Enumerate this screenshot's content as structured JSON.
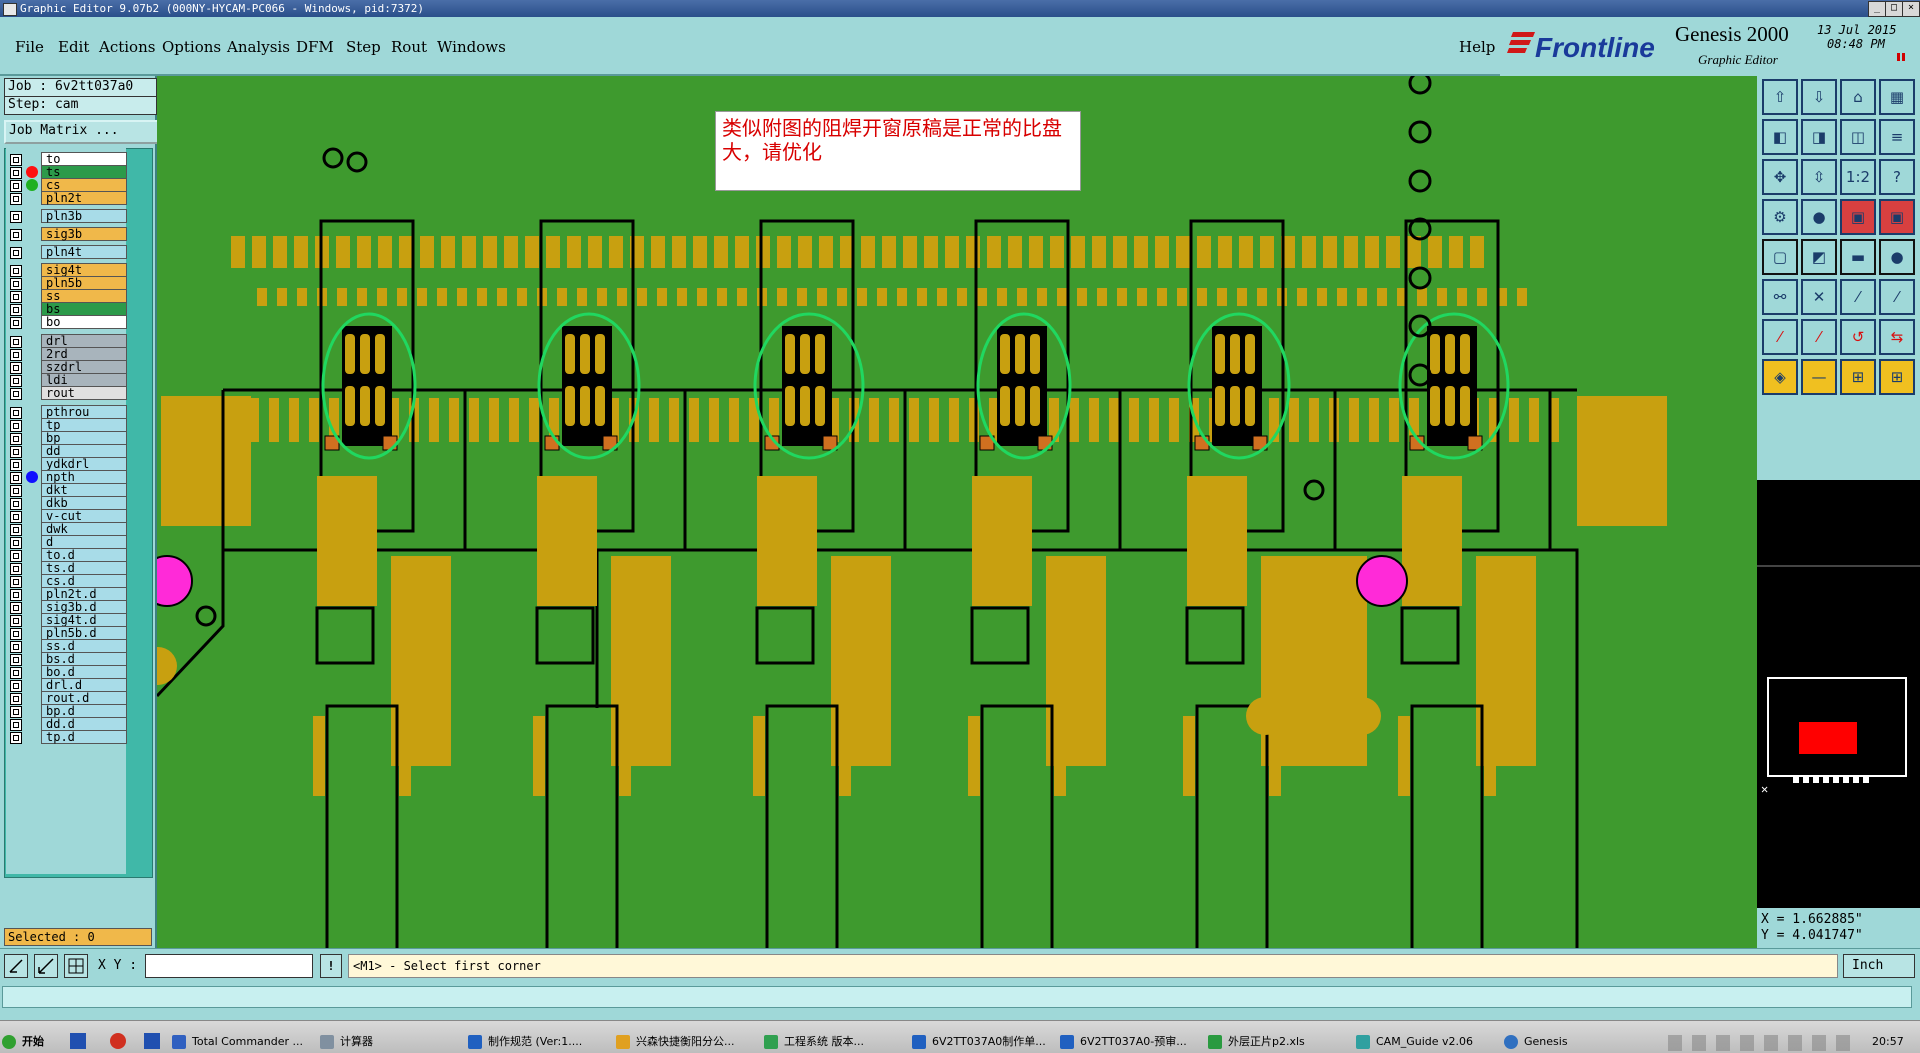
{
  "window": {
    "title": "Graphic Editor 9.07b2 (000NY-HYCAM-PC066 - Windows, pid:7372)",
    "controls": [
      "_",
      "□",
      "×"
    ]
  },
  "menu": [
    "File",
    "Edit",
    "Actions",
    "Options",
    "Analysis",
    "DFM",
    "Step",
    "Rout",
    "Windows"
  ],
  "help_label": "Help",
  "brand": {
    "logo": "Frontline",
    "product": "Genesis 2000",
    "subtitle": "Graphic Editor",
    "date": "13 Jul 2015",
    "time": "08:48 PM"
  },
  "job": {
    "job_label": "Job : 6v2tt037a0",
    "step_label": "Step: cam",
    "matrix_button": "Job Matrix ..."
  },
  "layers": [
    {
      "name": "to",
      "color": "#ffffff",
      "dot": ""
    },
    {
      "name": "ts",
      "color": "#2c9a4a",
      "dot": "#ff1010"
    },
    {
      "name": "cs",
      "color": "#f0b84a",
      "dot": "#20b020"
    },
    {
      "name": "pln2t",
      "color": "#f0b84a",
      "dot": ""
    },
    {
      "name": "pln3b",
      "color": "#a8dce8",
      "dot": ""
    },
    {
      "name": "sig3b",
      "color": "#f0b84a",
      "dot": ""
    },
    {
      "name": "pln4t",
      "color": "#a8dce8",
      "dot": ""
    },
    {
      "name": "sig4t",
      "color": "#f0b84a",
      "dot": ""
    },
    {
      "name": "pln5b",
      "color": "#f0b84a",
      "dot": ""
    },
    {
      "name": "ss",
      "color": "#f0b84a",
      "dot": ""
    },
    {
      "name": "bs",
      "color": "#2c9a4a",
      "dot": ""
    },
    {
      "name": "bo",
      "color": "#ffffff",
      "dot": ""
    },
    {
      "name": "drl",
      "color": "#a8b4bc",
      "dot": ""
    },
    {
      "name": "2rd",
      "color": "#a8b4bc",
      "dot": ""
    },
    {
      "name": "szdrl",
      "color": "#a8b4bc",
      "dot": ""
    },
    {
      "name": "ldi",
      "color": "#a8b4bc",
      "dot": ""
    },
    {
      "name": "rout",
      "color": "#e0e0e0",
      "dot": ""
    },
    {
      "name": "pthrou",
      "color": "#a8dce8",
      "dot": ""
    },
    {
      "name": "tp",
      "color": "#a8dce8",
      "dot": ""
    },
    {
      "name": "bp",
      "color": "#a8dce8",
      "dot": ""
    },
    {
      "name": "dd",
      "color": "#a8dce8",
      "dot": ""
    },
    {
      "name": "ydkdrl",
      "color": "#a8dce8",
      "dot": ""
    },
    {
      "name": "npth",
      "color": "#a8dce8",
      "dot": "#1010ff"
    },
    {
      "name": "dkt",
      "color": "#a8dce8",
      "dot": ""
    },
    {
      "name": "dkb",
      "color": "#a8dce8",
      "dot": ""
    },
    {
      "name": "v-cut",
      "color": "#a8dce8",
      "dot": ""
    },
    {
      "name": "dwk",
      "color": "#a8dce8",
      "dot": ""
    },
    {
      "name": "d",
      "color": "#a8dce8",
      "dot": ""
    },
    {
      "name": "to.d",
      "color": "#a8dce8",
      "dot": ""
    },
    {
      "name": "ts.d",
      "color": "#a8dce8",
      "dot": ""
    },
    {
      "name": "cs.d",
      "color": "#a8dce8",
      "dot": ""
    },
    {
      "name": "pln2t.d",
      "color": "#a8dce8",
      "dot": ""
    },
    {
      "name": "sig3b.d",
      "color": "#a8dce8",
      "dot": ""
    },
    {
      "name": "sig4t.d",
      "color": "#a8dce8",
      "dot": ""
    },
    {
      "name": "pln5b.d",
      "color": "#a8dce8",
      "dot": ""
    },
    {
      "name": "ss.d",
      "color": "#a8dce8",
      "dot": ""
    },
    {
      "name": "bs.d",
      "color": "#a8dce8",
      "dot": ""
    },
    {
      "name": "bo.d",
      "color": "#a8dce8",
      "dot": ""
    },
    {
      "name": "drl.d",
      "color": "#a8dce8",
      "dot": ""
    },
    {
      "name": "rout.d",
      "color": "#a8dce8",
      "dot": ""
    },
    {
      "name": "bp.d",
      "color": "#a8dce8",
      "dot": ""
    },
    {
      "name": "dd.d",
      "color": "#a8dce8",
      "dot": ""
    },
    {
      "name": "tp.d",
      "color": "#a8dce8",
      "dot": ""
    }
  ],
  "selected_label": "Selected : 0",
  "annotation": "类似附图的阻焊开窗原稿是正常的比盘大，请优化",
  "coords": {
    "x": "X = 1.662885\"",
    "y": "Y = 4.041747\""
  },
  "xy_label": "X Y :",
  "xy_value": "",
  "prompt": "<M1> - Select first corner",
  "units": "Inch",
  "colors": {
    "board": "#3e9a2e",
    "pad": "#c8a010",
    "ellipse": "#20d860",
    "fiducial": "#ff2ad8",
    "text_red": "#d80000"
  },
  "taskbar": {
    "start": "开始",
    "items": [
      "Total Commander ...",
      "计算器",
      "制作规范 (Ver:1....",
      "兴森快捷衡阳分公...",
      "工程系统    版本...",
      "6V2TT037A0制作单...",
      "6V2TT037A0-预审...",
      "外层正片p2.xls",
      "CAM_Guide v2.06",
      "Genesis"
    ],
    "clock": "20:57"
  }
}
